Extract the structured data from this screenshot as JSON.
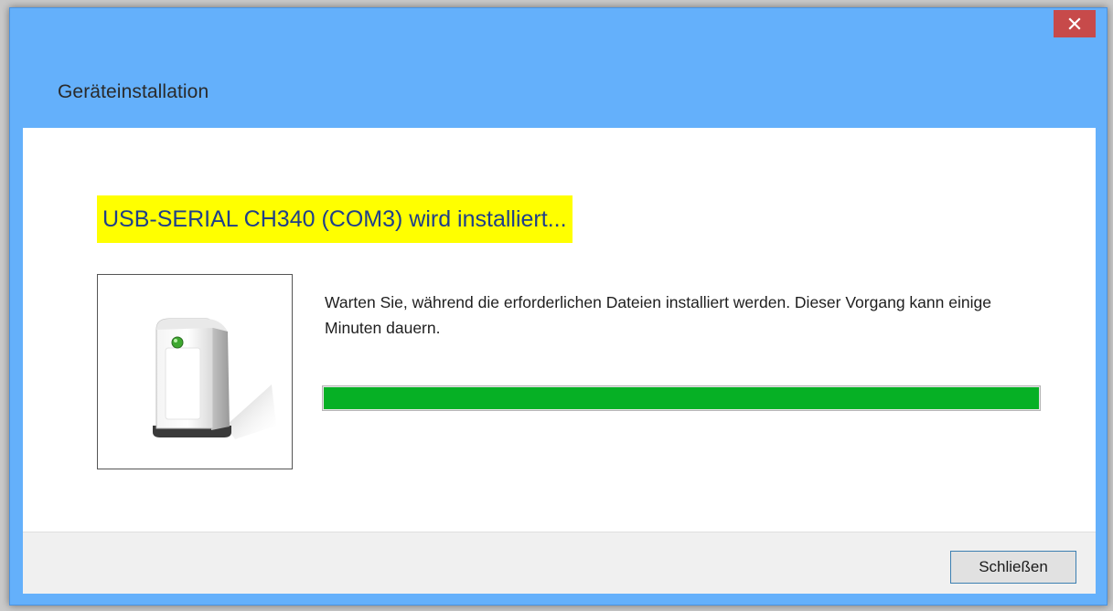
{
  "window": {
    "title": "Geräteinstallation",
    "close_glyph": "✕"
  },
  "content": {
    "heading": "USB-SERIAL CH340 (COM3) wird installiert...",
    "message": "Warten Sie, während die erforderlichen Dateien installiert werden. Dieser Vorgang kann einige Minuten dauern.",
    "device_icon": "usb-device-icon",
    "progress_fraction": 1.0
  },
  "footer": {
    "close_label": "Schließen"
  },
  "colors": {
    "titlebar": "#64b0fb",
    "close_button": "#c74a4a",
    "heading_highlight": "#ffff00",
    "heading_text": "#1f3f8a",
    "progress_fill": "#06b025"
  }
}
